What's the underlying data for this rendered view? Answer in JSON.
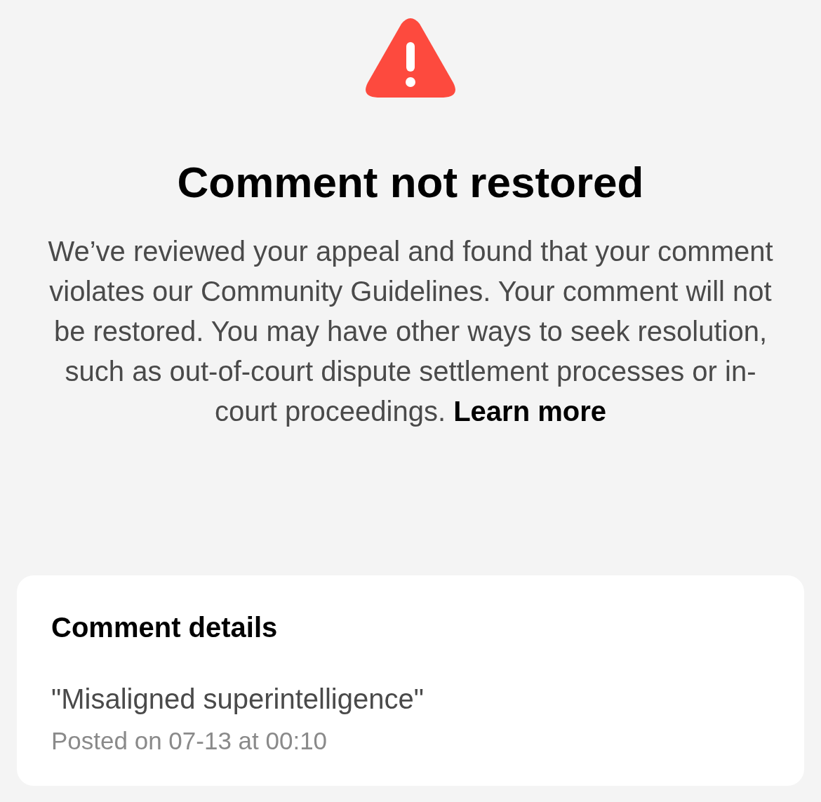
{
  "alert": {
    "title": "Comment not restored",
    "message": "We’ve reviewed your appeal and found that your comment violates our Community Guidelines. Your comment will not be restored. You may have other ways to seek resolution, such as out-of-court dispute settlement processes or in-court proceedings.",
    "link": "Learn more"
  },
  "details": {
    "heading": "Comment details",
    "comment": "\"Misaligned superintelligence\"",
    "posted": "Posted on 07-13 at 00:10"
  }
}
